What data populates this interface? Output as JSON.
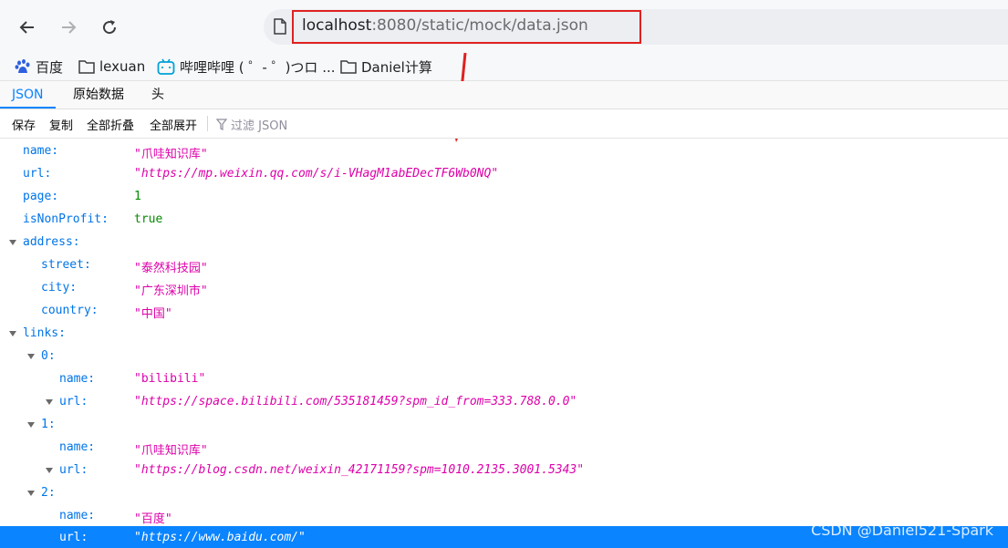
{
  "browser": {
    "address_host": "localhost",
    "address_rest": ":8080/static/mock/data.json",
    "bookmarks": [
      {
        "label": "百度"
      },
      {
        "label": "lexuan"
      },
      {
        "label": "哔哩哔哩 ( ゜- ゜)つロ ..."
      },
      {
        "label": "Daniel计算"
      }
    ]
  },
  "viewer": {
    "tabs": [
      "JSON",
      "原始数据",
      "头"
    ],
    "actions": [
      "保存",
      "复制",
      "全部折叠",
      "全部展开"
    ],
    "filter_placeholder": "过滤 JSON"
  },
  "json_rows": [
    {
      "key": "name:",
      "value": "\"爪哇知识库\""
    },
    {
      "key": "url:",
      "value": "\"https://mp.weixin.qq.com/s/i-VHagM1abEDecTF6Wb0NQ\""
    },
    {
      "key": "page:",
      "value": "1"
    },
    {
      "key": "isNonProfit:",
      "value": "true"
    },
    {
      "key": "address:",
      "value": ""
    },
    {
      "key": "street:",
      "value": "\"泰然科技园\""
    },
    {
      "key": "city:",
      "value": "\"广东深圳市\""
    },
    {
      "key": "country:",
      "value": "\"中国\""
    },
    {
      "key": "links:",
      "value": ""
    },
    {
      "key": "0:",
      "value": ""
    },
    {
      "key": "name:",
      "value": "\"bilibili\""
    },
    {
      "key": "url:",
      "value": "\"https://space.bilibili.com/535181459?spm_id_from=333.788.0.0\""
    },
    {
      "key": "1:",
      "value": ""
    },
    {
      "key": "name:",
      "value": "\"爪哇知识库\""
    },
    {
      "key": "url:",
      "value": "\"https://blog.csdn.net/weixin_42171159?spm=1010.2135.3001.5343\""
    },
    {
      "key": "2:",
      "value": ""
    },
    {
      "key": "name:",
      "value": "\"百度\""
    },
    {
      "key": "url:",
      "value": "\"https://www.baidu.com/\""
    }
  ],
  "watermark": "CSDN @Daniel521-Spark",
  "colors": {
    "accent": "#0a84ff",
    "string": "#dd00a9",
    "number": "#058b00",
    "key": "#0074e8",
    "highlight_box": "#e02020"
  }
}
